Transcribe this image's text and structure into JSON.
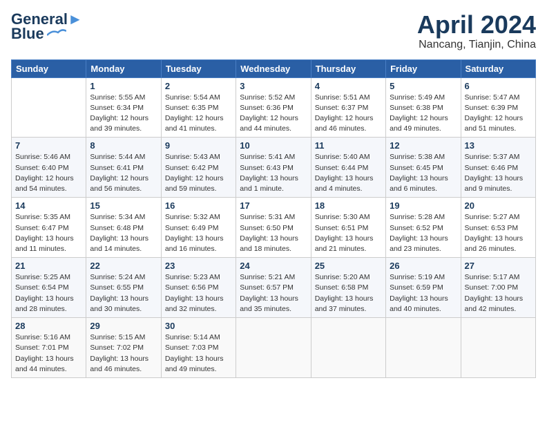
{
  "logo": {
    "line1": "General",
    "line2": "Blue"
  },
  "title": "April 2024",
  "location": "Nancang, Tianjin, China",
  "days_of_week": [
    "Sunday",
    "Monday",
    "Tuesday",
    "Wednesday",
    "Thursday",
    "Friday",
    "Saturday"
  ],
  "weeks": [
    [
      {
        "day": "",
        "info": ""
      },
      {
        "day": "1",
        "info": "Sunrise: 5:55 AM\nSunset: 6:34 PM\nDaylight: 12 hours\nand 39 minutes."
      },
      {
        "day": "2",
        "info": "Sunrise: 5:54 AM\nSunset: 6:35 PM\nDaylight: 12 hours\nand 41 minutes."
      },
      {
        "day": "3",
        "info": "Sunrise: 5:52 AM\nSunset: 6:36 PM\nDaylight: 12 hours\nand 44 minutes."
      },
      {
        "day": "4",
        "info": "Sunrise: 5:51 AM\nSunset: 6:37 PM\nDaylight: 12 hours\nand 46 minutes."
      },
      {
        "day": "5",
        "info": "Sunrise: 5:49 AM\nSunset: 6:38 PM\nDaylight: 12 hours\nand 49 minutes."
      },
      {
        "day": "6",
        "info": "Sunrise: 5:47 AM\nSunset: 6:39 PM\nDaylight: 12 hours\nand 51 minutes."
      }
    ],
    [
      {
        "day": "7",
        "info": "Sunrise: 5:46 AM\nSunset: 6:40 PM\nDaylight: 12 hours\nand 54 minutes."
      },
      {
        "day": "8",
        "info": "Sunrise: 5:44 AM\nSunset: 6:41 PM\nDaylight: 12 hours\nand 56 minutes."
      },
      {
        "day": "9",
        "info": "Sunrise: 5:43 AM\nSunset: 6:42 PM\nDaylight: 12 hours\nand 59 minutes."
      },
      {
        "day": "10",
        "info": "Sunrise: 5:41 AM\nSunset: 6:43 PM\nDaylight: 13 hours\nand 1 minute."
      },
      {
        "day": "11",
        "info": "Sunrise: 5:40 AM\nSunset: 6:44 PM\nDaylight: 13 hours\nand 4 minutes."
      },
      {
        "day": "12",
        "info": "Sunrise: 5:38 AM\nSunset: 6:45 PM\nDaylight: 13 hours\nand 6 minutes."
      },
      {
        "day": "13",
        "info": "Sunrise: 5:37 AM\nSunset: 6:46 PM\nDaylight: 13 hours\nand 9 minutes."
      }
    ],
    [
      {
        "day": "14",
        "info": "Sunrise: 5:35 AM\nSunset: 6:47 PM\nDaylight: 13 hours\nand 11 minutes."
      },
      {
        "day": "15",
        "info": "Sunrise: 5:34 AM\nSunset: 6:48 PM\nDaylight: 13 hours\nand 14 minutes."
      },
      {
        "day": "16",
        "info": "Sunrise: 5:32 AM\nSunset: 6:49 PM\nDaylight: 13 hours\nand 16 minutes."
      },
      {
        "day": "17",
        "info": "Sunrise: 5:31 AM\nSunset: 6:50 PM\nDaylight: 13 hours\nand 18 minutes."
      },
      {
        "day": "18",
        "info": "Sunrise: 5:30 AM\nSunset: 6:51 PM\nDaylight: 13 hours\nand 21 minutes."
      },
      {
        "day": "19",
        "info": "Sunrise: 5:28 AM\nSunset: 6:52 PM\nDaylight: 13 hours\nand 23 minutes."
      },
      {
        "day": "20",
        "info": "Sunrise: 5:27 AM\nSunset: 6:53 PM\nDaylight: 13 hours\nand 26 minutes."
      }
    ],
    [
      {
        "day": "21",
        "info": "Sunrise: 5:25 AM\nSunset: 6:54 PM\nDaylight: 13 hours\nand 28 minutes."
      },
      {
        "day": "22",
        "info": "Sunrise: 5:24 AM\nSunset: 6:55 PM\nDaylight: 13 hours\nand 30 minutes."
      },
      {
        "day": "23",
        "info": "Sunrise: 5:23 AM\nSunset: 6:56 PM\nDaylight: 13 hours\nand 32 minutes."
      },
      {
        "day": "24",
        "info": "Sunrise: 5:21 AM\nSunset: 6:57 PM\nDaylight: 13 hours\nand 35 minutes."
      },
      {
        "day": "25",
        "info": "Sunrise: 5:20 AM\nSunset: 6:58 PM\nDaylight: 13 hours\nand 37 minutes."
      },
      {
        "day": "26",
        "info": "Sunrise: 5:19 AM\nSunset: 6:59 PM\nDaylight: 13 hours\nand 40 minutes."
      },
      {
        "day": "27",
        "info": "Sunrise: 5:17 AM\nSunset: 7:00 PM\nDaylight: 13 hours\nand 42 minutes."
      }
    ],
    [
      {
        "day": "28",
        "info": "Sunrise: 5:16 AM\nSunset: 7:01 PM\nDaylight: 13 hours\nand 44 minutes."
      },
      {
        "day": "29",
        "info": "Sunrise: 5:15 AM\nSunset: 7:02 PM\nDaylight: 13 hours\nand 46 minutes."
      },
      {
        "day": "30",
        "info": "Sunrise: 5:14 AM\nSunset: 7:03 PM\nDaylight: 13 hours\nand 49 minutes."
      },
      {
        "day": "",
        "info": ""
      },
      {
        "day": "",
        "info": ""
      },
      {
        "day": "",
        "info": ""
      },
      {
        "day": "",
        "info": ""
      }
    ]
  ]
}
